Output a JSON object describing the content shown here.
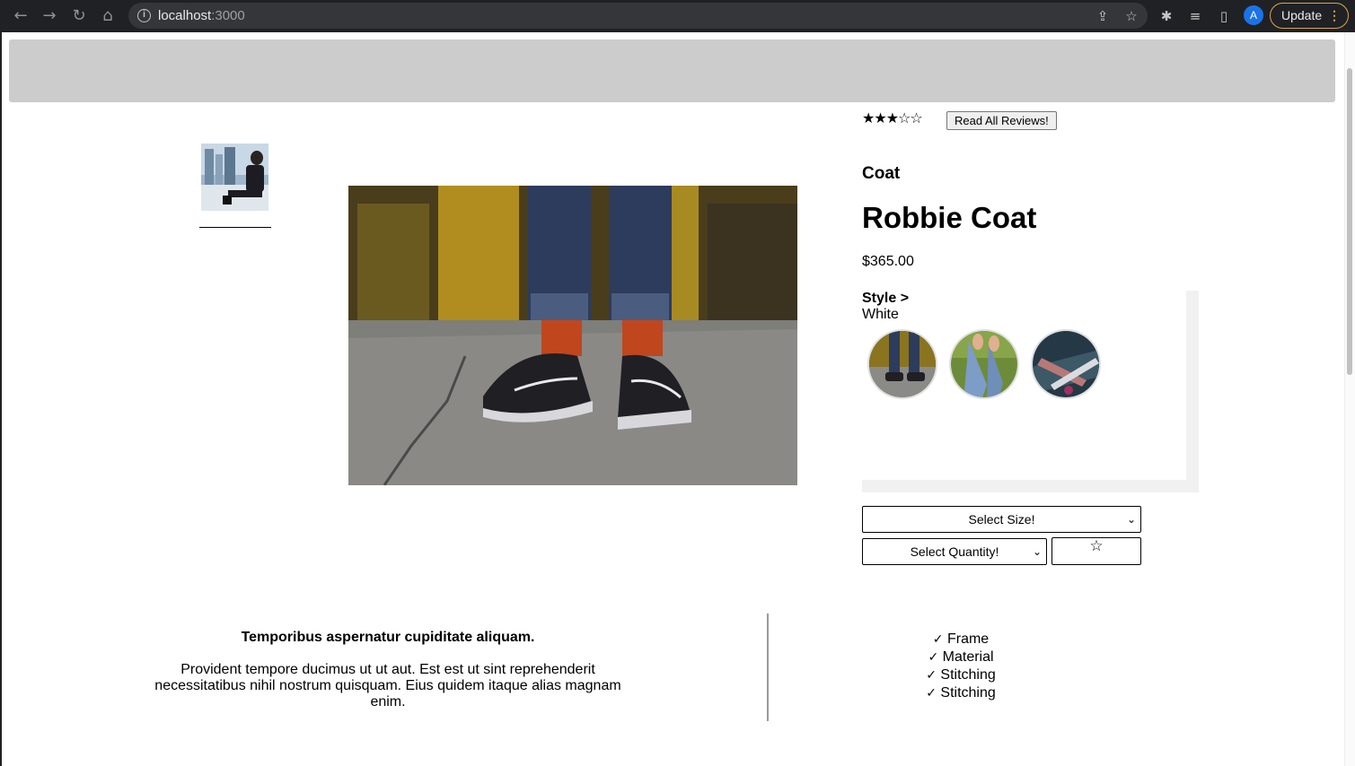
{
  "browser": {
    "url_host": "localhost",
    "url_port": ":3000",
    "avatar_letter": "A",
    "update_label": "Update"
  },
  "product": {
    "rating": 3,
    "rating_max": 5,
    "stars_display": "★★★☆☆",
    "reviews_button": "Read All Reviews!",
    "category": "Coat",
    "name": "Robbie Coat",
    "price": "$365.00"
  },
  "style": {
    "label": "Style >",
    "selected": "White",
    "swatches": [
      "sneakers-photo",
      "grass-feet-photo",
      "skate-photo"
    ]
  },
  "cart": {
    "size_select": "Select Size!",
    "quantity_select": "Select Quantity!",
    "favorite_icon": "☆"
  },
  "description": {
    "heading": "Temporibus aspernatur cupiditate aliquam.",
    "body": "Provident tempore ducimus ut ut aut. Est est ut sint reprehenderit necessitatibus nihil nostrum quisquam. Eius quidem itaque alias magnam enim."
  },
  "features": [
    "Frame",
    "Material",
    "Stitching",
    "Stitching"
  ],
  "colors": {
    "banner": "#cccccc",
    "chrome": "#202124",
    "update_accent": "#d9a54a"
  }
}
